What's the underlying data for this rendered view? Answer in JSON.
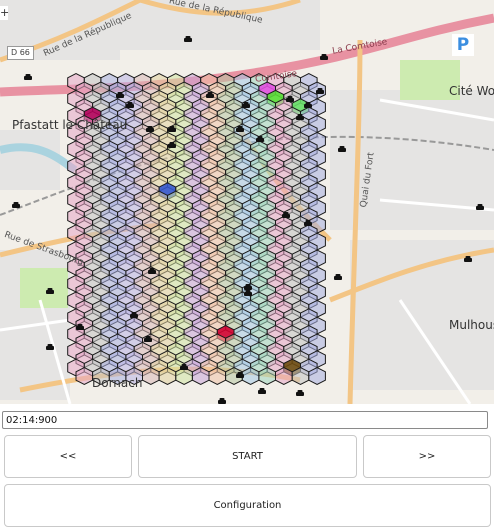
{
  "map": {
    "zoom_in_label": "+",
    "road_shield": "D 66",
    "parking_label": "P",
    "street_labels": [
      "Rue de la République",
      "Rue de la République",
      "La Comtoise",
      "Comtoise",
      "Pfastatt le Château",
      "Cité Wolf-",
      "Quai du Fort",
      "Rue de Strasbourg",
      "Mulhouse",
      "Dornach"
    ],
    "vehicle_icon": "car-icon",
    "colors": {
      "land": "#f2efe9",
      "residential": "#e0dfdf",
      "park": "#cdebb0",
      "water": "#aad3df",
      "road_major": "#e892a2",
      "road_secondary": "#f7fabf",
      "railway": "#999999",
      "hex_outline": "#1a1a1a"
    }
  },
  "controls": {
    "time_value": "02:14:900",
    "prev_label": "<<",
    "start_label": "START",
    "next_label": ">>",
    "config_label": "Configuration"
  }
}
